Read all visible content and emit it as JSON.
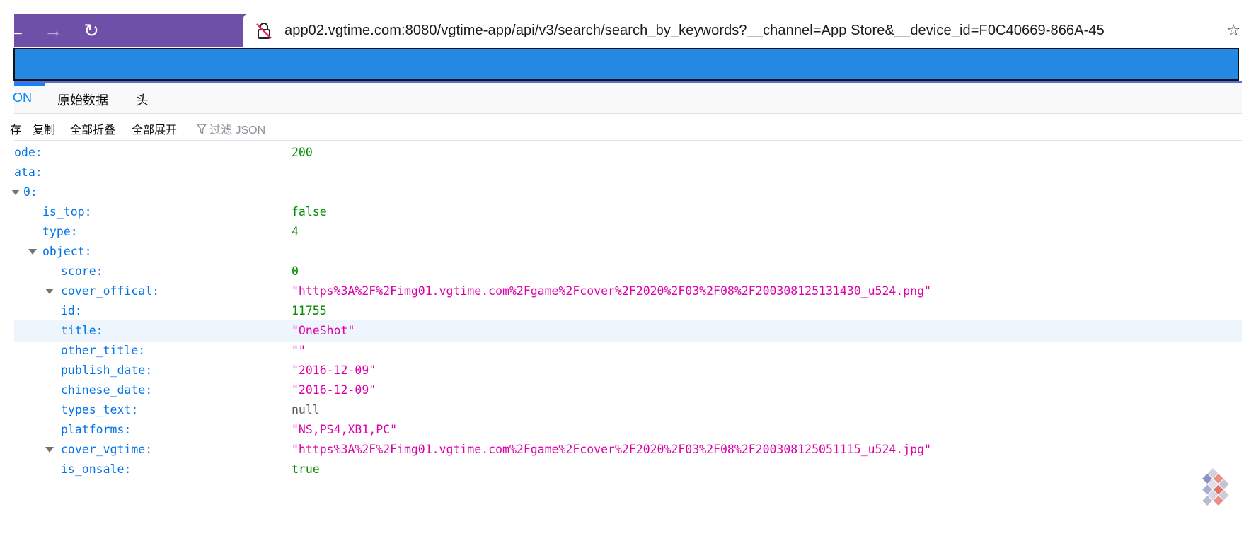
{
  "browser": {
    "url": "app02.vgtime.com:8080/vgtime-app/api/v3/search/search_by_keywords?__channel=App Store&__device_id=F0C40669-866A-45",
    "back_icon": "←",
    "forward_icon": "→",
    "reload_icon": "↻",
    "bookmark_icon": "☆",
    "close_icon": "✕"
  },
  "viewer_tabs": [
    {
      "label": "ON"
    },
    {
      "label": "原始数据"
    },
    {
      "label": "头"
    }
  ],
  "actions": {
    "save": "存",
    "copy": "复制",
    "collapse_all": "全部折叠",
    "expand_all": "全部展开",
    "filter_placeholder": "过滤 JSON"
  },
  "json_rows": [
    {
      "key": "ode:",
      "value": "200"
    },
    {
      "key": "ata:",
      "value": ""
    },
    {
      "key": "0:",
      "value": ""
    },
    {
      "key": "is_top:",
      "value": "false"
    },
    {
      "key": "type:",
      "value": "4"
    },
    {
      "key": "object:",
      "value": ""
    },
    {
      "key": "score:",
      "value": "0"
    },
    {
      "key": "cover_offical:",
      "value": "\"https%3A%2F%2Fimg01.vgtime.com%2Fgame%2Fcover%2F2020%2F03%2F08%2F200308125131430_u524.png\""
    },
    {
      "key": "id:",
      "value": "11755"
    },
    {
      "key": "title:",
      "value": "\"OneShot\""
    },
    {
      "key": "other_title:",
      "value": "\"\""
    },
    {
      "key": "publish_date:",
      "value": "\"2016-12-09\""
    },
    {
      "key": "chinese_date:",
      "value": "\"2016-12-09\""
    },
    {
      "key": "types_text:",
      "value": "null"
    },
    {
      "key": "platforms:",
      "value": "\"NS,PS4,XB1,PC\""
    },
    {
      "key": "cover_vgtime:",
      "value": "\"https%3A%2F%2Fimg01.vgtime.com%2Fgame%2Fcover%2F2020%2F03%2F08%2F200308125051115_u524.jpg\""
    },
    {
      "key": "is_onsale:",
      "value": "true"
    }
  ],
  "colors": {
    "toolbar": "#6f50a8",
    "banner": "#2389e4",
    "key": "#0074e8",
    "number": "#058b00",
    "string": "#dd00a9",
    "null": "#5c5c5c"
  }
}
